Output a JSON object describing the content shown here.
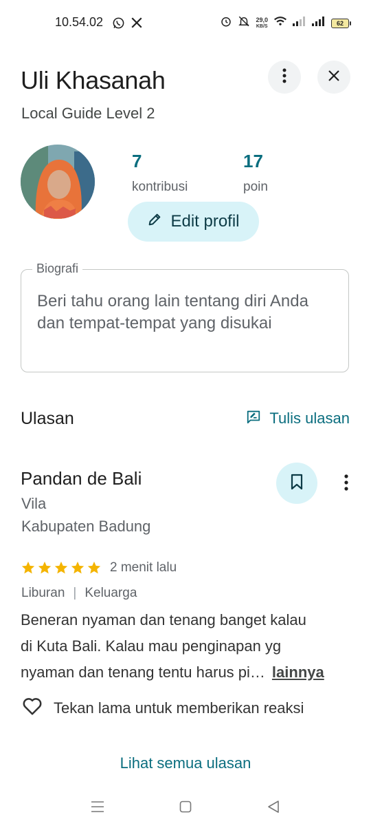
{
  "status_bar": {
    "time": "10.54.02",
    "net_speed_value": "29,0",
    "net_speed_unit": "KB/S",
    "battery_level": "62",
    "app_icons": [
      "whatsapp-icon",
      "x-icon"
    ],
    "status_icons": [
      "alarm-icon",
      "mute-icon",
      "wifi-icon",
      "signal-icon",
      "signal-icon",
      "battery-icon"
    ]
  },
  "header": {
    "name": "Uli Khasanah",
    "guide_level": "Local Guide Level 2",
    "more_icon": "more-vert-icon",
    "close_icon": "close-icon"
  },
  "stats": {
    "contributions_value": "7",
    "contributions_label": "kontribusi",
    "points_value": "17",
    "points_label": "poin"
  },
  "edit_profile": {
    "label": "Edit profil",
    "icon": "pencil-icon"
  },
  "bio": {
    "label": "Biografi",
    "placeholder": "Beri tahu orang lain tentang diri Anda dan tempat-tempat yang disukai"
  },
  "reviews": {
    "title": "Ulasan",
    "write_label": "Tulis ulasan",
    "write_icon": "rate-review-icon",
    "see_all_label": "Lihat semua ulasan"
  },
  "review": {
    "place_name": "Pandan de Bali",
    "category": "Vila",
    "location": "Kabupaten Badung",
    "rating": 5,
    "time": "2 menit lalu",
    "tags": [
      "Liburan",
      "Keluarga"
    ],
    "tag_separator": "|",
    "text_lines": [
      "Beneran nyaman dan tenang banget kalau",
      "di Kuta Bali. Kalau mau penginapan yg",
      "nyaman dan tenang tentu harus pi…"
    ],
    "more_label": "lainnya",
    "reaction_label": "Tekan lama untuk memberikan reaksi",
    "star_color": "#f4b400"
  },
  "colors": {
    "accent": "#0b6e7f",
    "chip_bg": "#d8f3f8"
  }
}
